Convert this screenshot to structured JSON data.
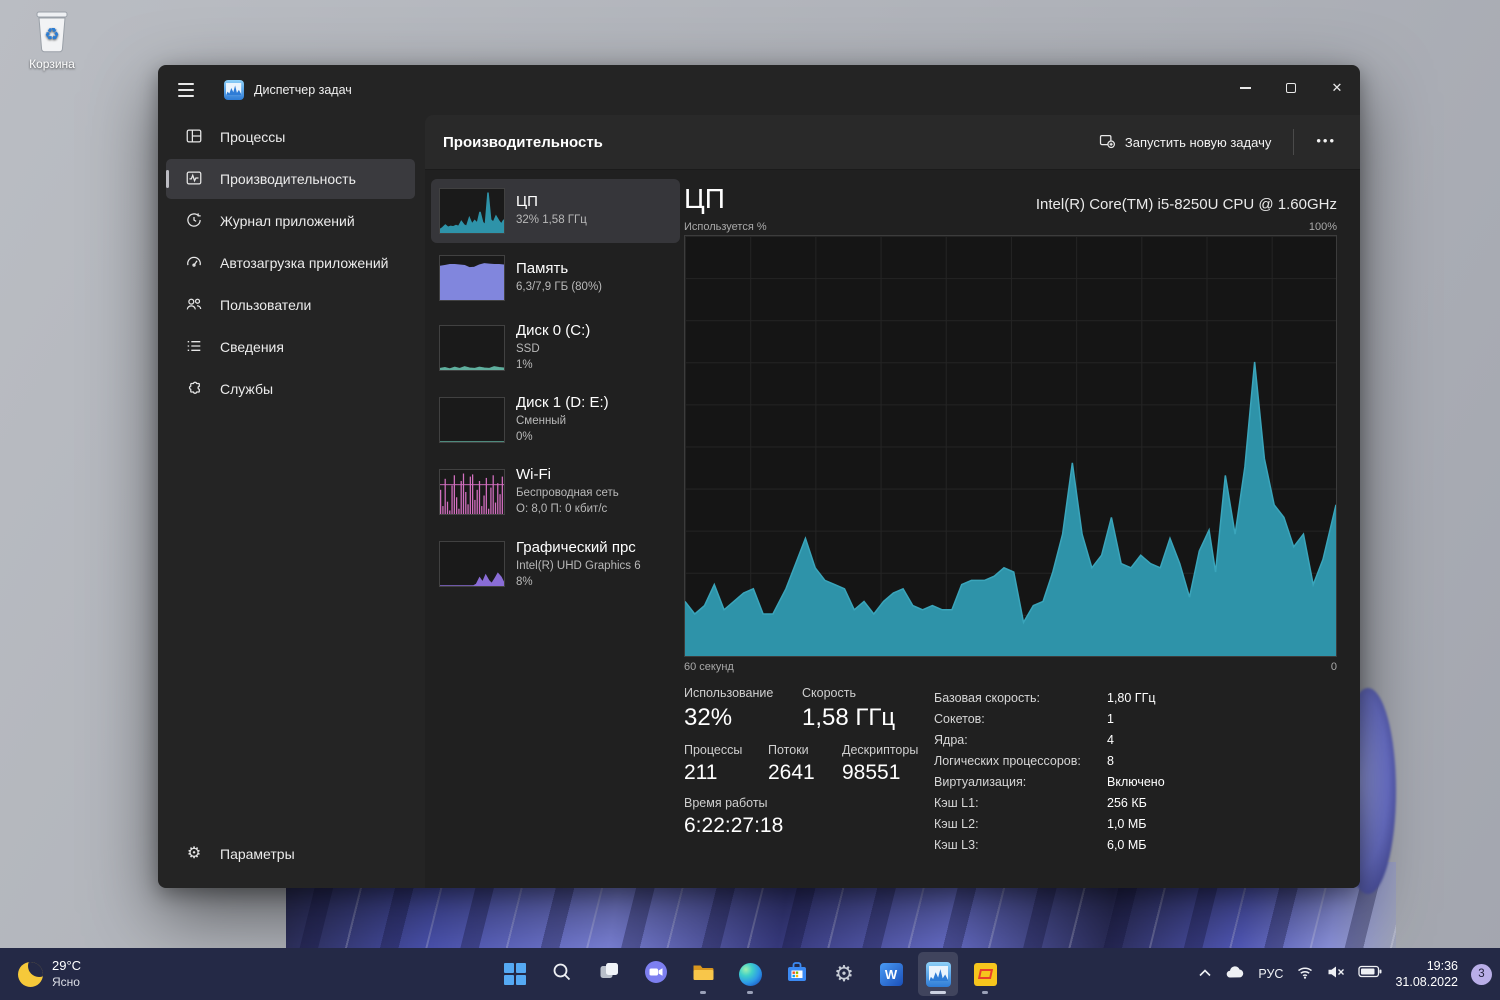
{
  "desktop": {
    "recycle_bin_label": "Корзина"
  },
  "window": {
    "title": "Диспетчер задач",
    "sidebar": {
      "items": [
        {
          "label": "Процессы"
        },
        {
          "label": "Производительность"
        },
        {
          "label": "Журнал приложений"
        },
        {
          "label": "Автозагрузка приложений"
        },
        {
          "label": "Пользователи"
        },
        {
          "label": "Сведения"
        },
        {
          "label": "Службы"
        }
      ],
      "settings_label": "Параметры"
    },
    "header": {
      "title": "Производительность",
      "run_new_task": "Запустить новую задачу",
      "more": "•••"
    },
    "tiles": [
      {
        "name": "ЦП",
        "line1": "32%  1,58 ГГц"
      },
      {
        "name": "Память",
        "line1": "6,3/7,9 ГБ (80%)"
      },
      {
        "name": "Диск 0 (C:)",
        "line1": "SSD",
        "line2": "1%"
      },
      {
        "name": "Диск 1 (D: E:)",
        "line1": "Сменный",
        "line2": "0%"
      },
      {
        "name": "Wi-Fi",
        "line1": "Беспроводная сеть",
        "line2": "О: 8,0 П: 0 кбит/с"
      },
      {
        "name": "Графический прс",
        "line1": "Intel(R) UHD Graphics 6",
        "line2": "8%"
      }
    ],
    "main": {
      "title": "ЦП",
      "cpu_name": "Intel(R) Core(TM) i5-8250U CPU @ 1.60GHz",
      "axis_top_left": "Используется %",
      "axis_top_right": "100%",
      "axis_bottom_left": "60 секунд",
      "axis_bottom_right": "0",
      "usage_label": "Использование",
      "usage_value": "32%",
      "speed_label": "Скорость",
      "speed_value": "1,58 ГГц",
      "processes_label": "Процессы",
      "processes_value": "211",
      "threads_label": "Потоки",
      "threads_value": "2641",
      "handles_label": "Дескрипторы",
      "handles_value": "98551",
      "uptime_label": "Время работы",
      "uptime_value": "6:22:27:18",
      "stats_right": [
        {
          "label": "Базовая скорость:",
          "value": "1,80 ГГц"
        },
        {
          "label": "Сокетов:",
          "value": "1"
        },
        {
          "label": "Ядра:",
          "value": "4"
        },
        {
          "label": "Логических процессоров:",
          "value": "8"
        },
        {
          "label": "Виртуализация:",
          "value": "Включено"
        },
        {
          "label": "Кэш L1:",
          "value": "256 КБ"
        },
        {
          "label": "Кэш L2:",
          "value": "1,0 МБ"
        },
        {
          "label": "Кэш L3:",
          "value": "6,0 МБ"
        }
      ]
    }
  },
  "taskbar": {
    "weather": {
      "temp": "29°C",
      "condition": "Ясно"
    },
    "tray": {
      "language": "РУС",
      "time": "19:36",
      "date": "31.08.2022",
      "badge": "3"
    },
    "word_letter": "W"
  },
  "chart_data": {
    "type": "area",
    "title": "ЦП — Используется %",
    "xlabel_left": "60 секунд",
    "xlabel_right": "0",
    "ylim": [
      0,
      100
    ],
    "y_top_label": "100%",
    "grid": true,
    "series": [
      {
        "name": "CPU usage %",
        "points": [
          [
            0,
            13
          ],
          [
            1.5,
            10
          ],
          [
            3,
            12
          ],
          [
            4.5,
            17
          ],
          [
            6,
            11
          ],
          [
            7.5,
            13
          ],
          [
            9,
            15
          ],
          [
            10.5,
            16
          ],
          [
            12,
            10
          ],
          [
            13.5,
            10
          ],
          [
            15.5,
            16
          ],
          [
            17,
            22
          ],
          [
            18.5,
            28
          ],
          [
            20,
            21
          ],
          [
            21.5,
            18
          ],
          [
            23,
            17
          ],
          [
            24.5,
            16
          ],
          [
            26,
            11
          ],
          [
            27.5,
            13
          ],
          [
            29,
            10
          ],
          [
            30.5,
            13
          ],
          [
            32,
            15
          ],
          [
            33.5,
            16
          ],
          [
            35,
            12
          ],
          [
            36.5,
            11
          ],
          [
            38,
            12
          ],
          [
            39.5,
            11
          ],
          [
            41,
            11
          ],
          [
            42.5,
            17
          ],
          [
            44,
            18
          ],
          [
            46,
            18
          ],
          [
            47.5,
            19
          ],
          [
            49,
            21
          ],
          [
            50.5,
            20
          ],
          [
            52,
            8
          ],
          [
            53.5,
            12
          ],
          [
            55,
            13
          ],
          [
            56.5,
            20
          ],
          [
            58,
            29
          ],
          [
            59.5,
            46
          ],
          [
            61,
            29
          ],
          [
            62.5,
            21
          ],
          [
            64,
            24
          ],
          [
            65.5,
            33
          ],
          [
            67,
            22
          ],
          [
            68.5,
            21
          ],
          [
            70,
            24
          ],
          [
            71.5,
            22
          ],
          [
            73,
            21
          ],
          [
            74.5,
            28
          ],
          [
            76,
            22
          ],
          [
            77.5,
            14
          ],
          [
            79,
            25
          ],
          [
            80.5,
            30
          ],
          [
            81.5,
            20
          ],
          [
            83,
            43
          ],
          [
            84.5,
            29
          ],
          [
            86,
            45
          ],
          [
            87.5,
            70
          ],
          [
            89,
            47
          ],
          [
            90.5,
            36
          ],
          [
            92,
            33
          ],
          [
            93.5,
            26
          ],
          [
            95,
            29
          ],
          [
            96.5,
            17
          ],
          [
            98,
            23
          ],
          [
            100,
            36
          ]
        ]
      }
    ],
    "sparklines": {
      "cpu": [
        8,
        12,
        18,
        13,
        15,
        14,
        17,
        15,
        26,
        18,
        15,
        34,
        20,
        28,
        22,
        48,
        24,
        18,
        92,
        30,
        24,
        38,
        28,
        20,
        30
      ],
      "memory": [
        76,
        78,
        80,
        80,
        79,
        78,
        73,
        74,
        79,
        82,
        81,
        80,
        80,
        79
      ],
      "disk0": [
        3,
        5,
        2,
        6,
        3,
        7,
        4,
        3,
        6,
        4,
        3,
        7,
        5,
        4
      ],
      "disk1": [
        0,
        0,
        0,
        0,
        0,
        0,
        0,
        0,
        0,
        0
      ],
      "gpu": [
        0,
        0,
        0,
        0,
        0,
        0,
        0,
        0,
        0,
        0,
        0,
        0,
        4,
        18,
        8,
        24,
        12,
        5,
        16,
        28,
        20,
        6
      ],
      "wifi_bars": [
        55,
        18,
        80,
        28,
        8,
        65,
        88,
        38,
        12,
        75,
        92,
        50,
        22,
        85,
        90,
        32,
        55,
        75,
        18,
        42,
        82,
        12,
        60,
        88,
        26,
        70,
        45,
        85
      ]
    },
    "colors": {
      "cpu": "#2e93a9",
      "memory": "#8186dd",
      "disk": "#5fae9d",
      "wifi": "#d36fc0",
      "gpu": "#8a6dd6"
    }
  }
}
